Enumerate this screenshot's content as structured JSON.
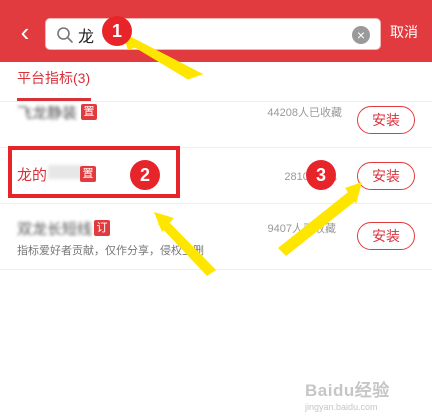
{
  "header": {
    "search": {
      "value": "龙"
    },
    "cancel_label": "取消",
    "colors": {
      "brand_red": "#e23b3f"
    }
  },
  "tab": {
    "label": "平台指标(3)"
  },
  "items": [
    {
      "name": "飞龙静装",
      "tag": "置",
      "count": "44208人已收藏",
      "install_label": "安装"
    },
    {
      "name": "龙的",
      "tag": "置",
      "count": "28100人已",
      "install_label": "安装"
    },
    {
      "name": "双龙长短线",
      "tag": "订",
      "desc": "指标爱好者贡献，仅作分享，侵权立删",
      "count": "9407人已收藏",
      "install_label": "安装"
    }
  ],
  "annotations": {
    "badge1": "1",
    "badge2": "2",
    "badge3": "3"
  },
  "watermark": {
    "main": "Baidu经验",
    "sub": "jingyan.baidu.com"
  }
}
